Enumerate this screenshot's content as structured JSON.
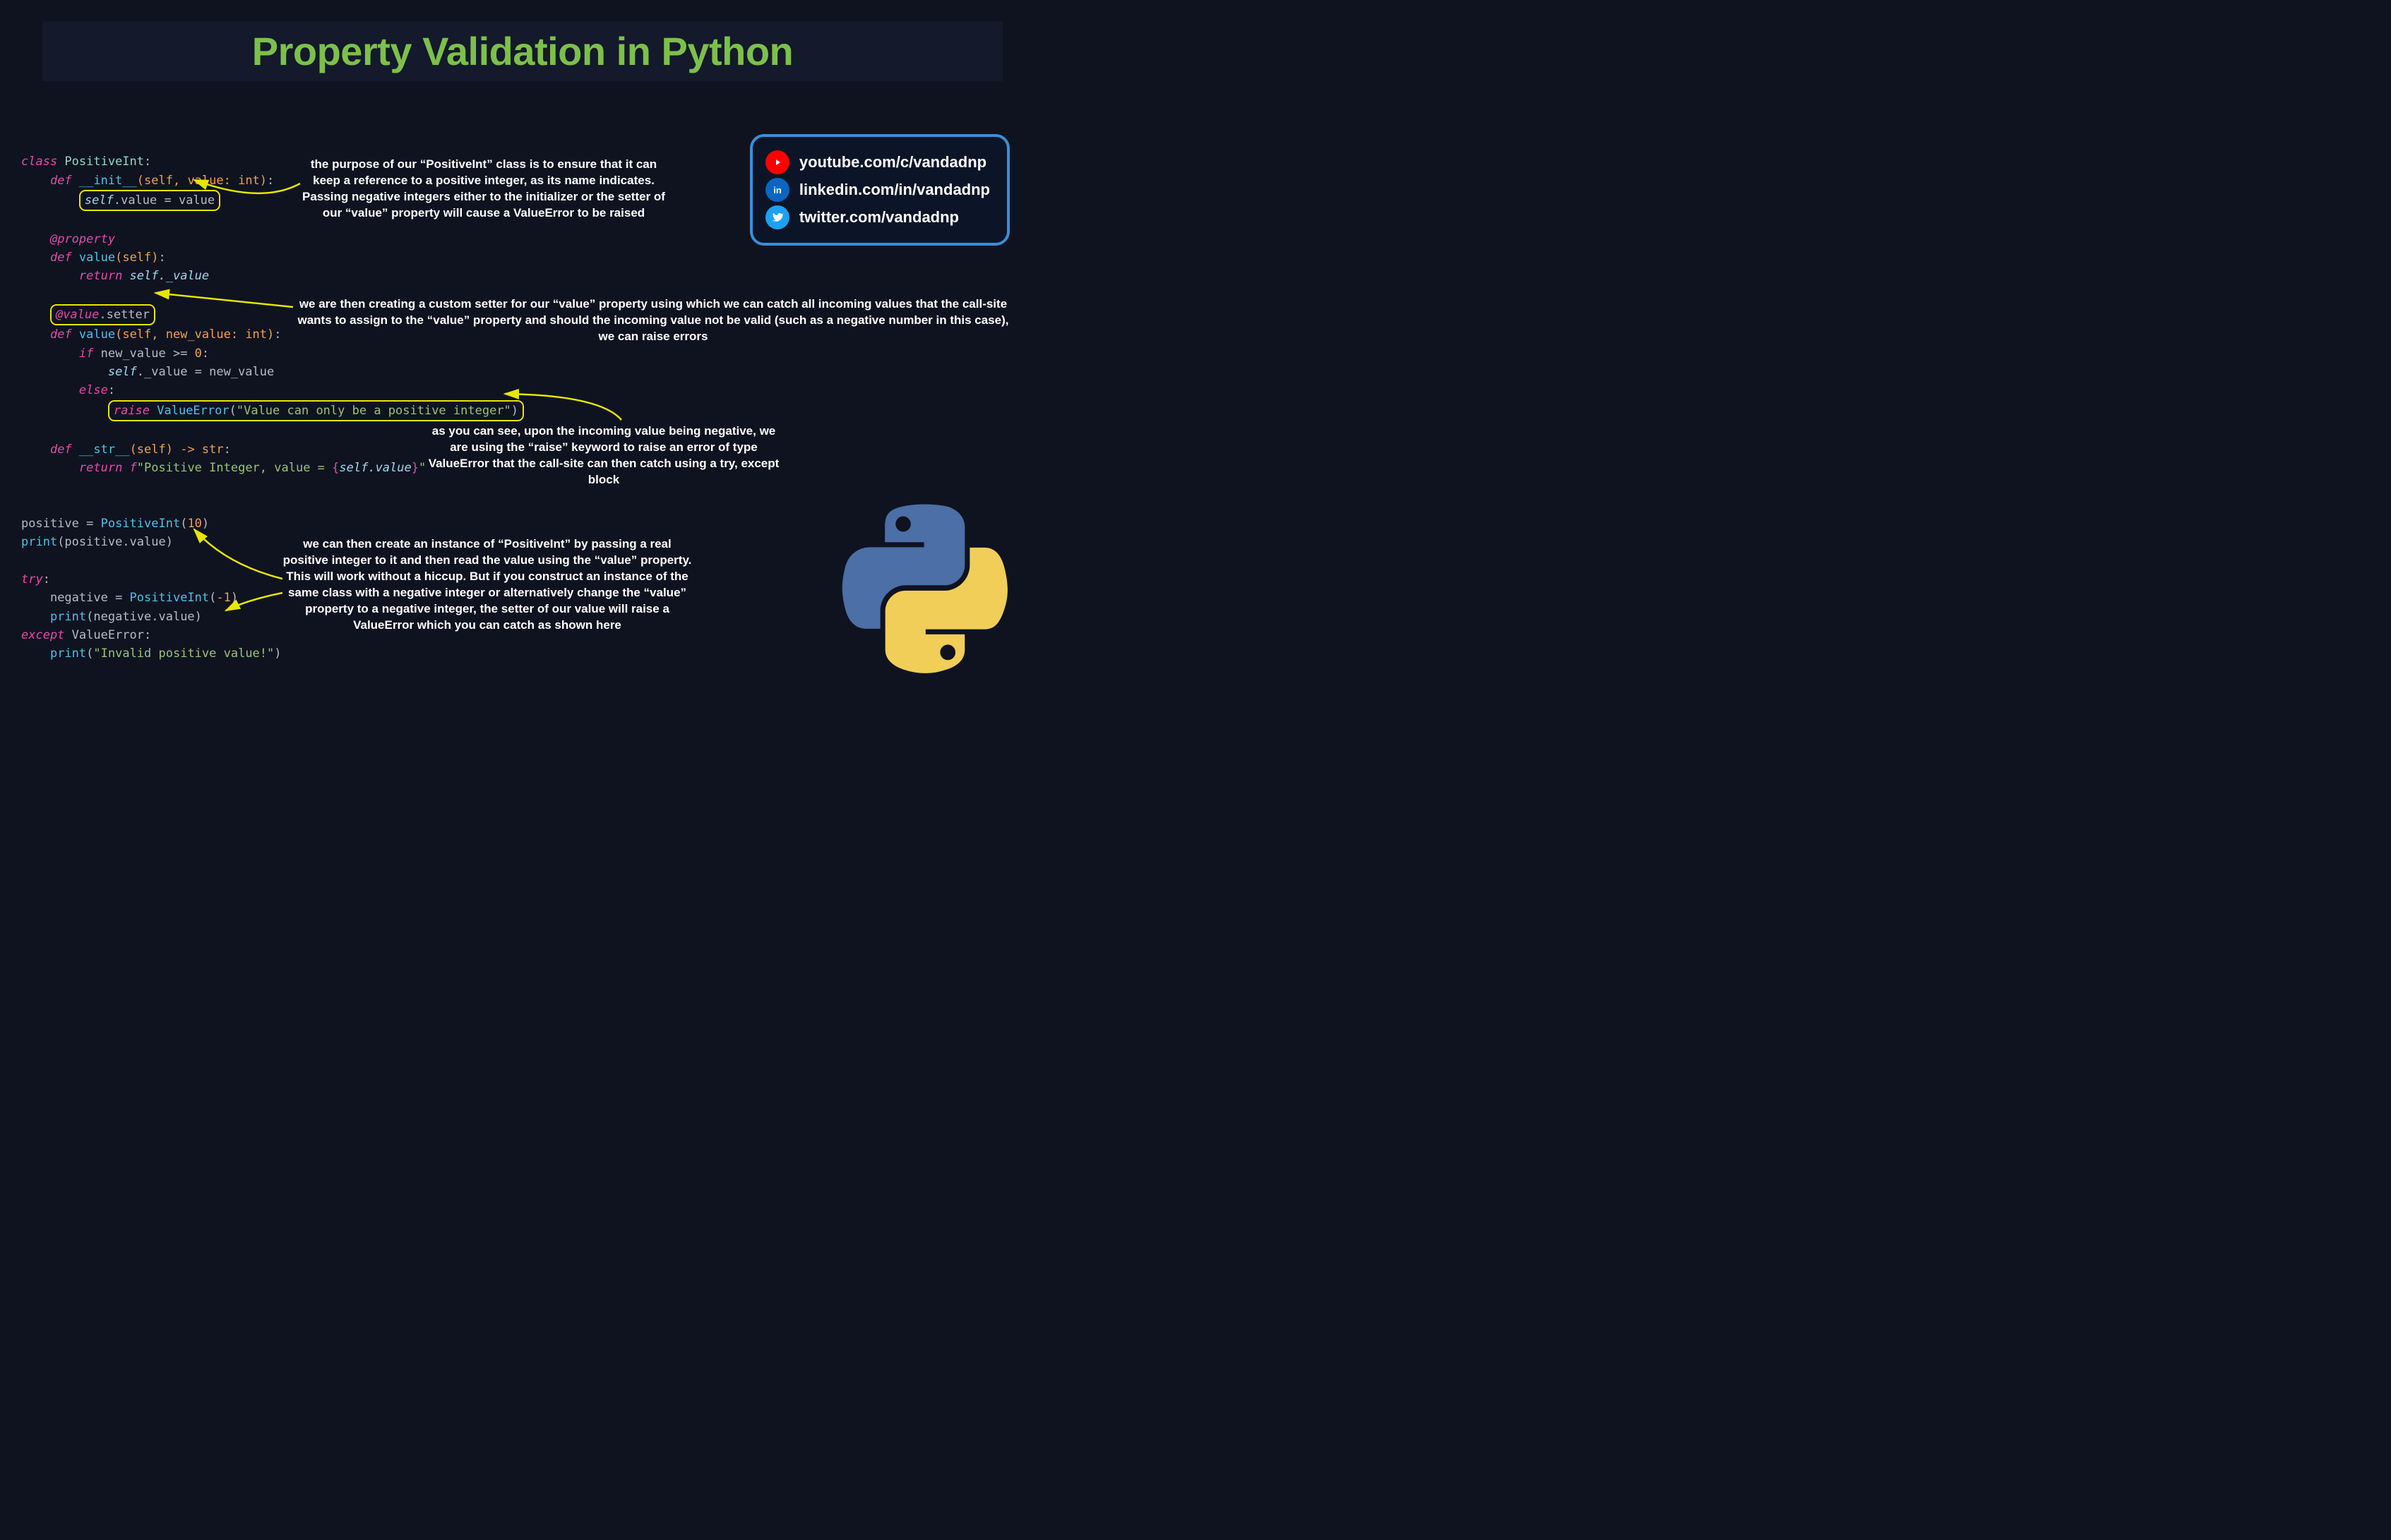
{
  "title": "Property Validation in Python",
  "social": {
    "youtube": "youtube.com/c/vandadnp",
    "linkedin": "linkedin.com/in/vandadnp",
    "twitter": "twitter.com/vandadnp"
  },
  "code": {
    "l1_class": "class",
    "l1_name": " PositiveInt",
    "l1_colon": ":",
    "l2_def": "def",
    "l2_fn": " __init__",
    "l2_params": "(self, value: int)",
    "l2_colon": ":",
    "l3_self": "self",
    "l3_dot_value_eq": ".value = value",
    "l5_deco": "@property",
    "l6_def": "def",
    "l6_fn": " value",
    "l6_params": "(self)",
    "l6_colon": ":",
    "l7_return": "return",
    "l7_selfval": " self._value",
    "l9_deco1": "@value",
    "l9_deco2": ".setter",
    "l10_def": "def",
    "l10_fn": " value",
    "l10_params": "(self, new_value: int)",
    "l10_colon": ":",
    "l11_if": "if",
    "l11_cond": " new_value >= ",
    "l11_zero": "0",
    "l11_colon": ":",
    "l12_self": "self",
    "l12_assign": "._value = new_value",
    "l13_else": "else",
    "l13_colon": ":",
    "l14_raise": "raise",
    "l14_err": " ValueError",
    "l14_paren_open": "(",
    "l14_str": "\"Value can only be a positive integer\"",
    "l14_paren_close": ")",
    "l16_def": "def",
    "l16_fn": " __str__",
    "l16_params": "(self) -> str",
    "l16_colon": ":",
    "l17_return": "return",
    "l17_fpre": " f",
    "l17_str1": "\"Positive Integer, value = ",
    "l17_brace_open": "{",
    "l17_selfv": "self.value",
    "l17_brace_close": "}",
    "l17_str2": "\"",
    "l20a": "positive = ",
    "l20b": "PositiveInt",
    "l20c": "(",
    "l20d": "10",
    "l20e": ")",
    "l21a": "print",
    "l21b": "(positive.value)",
    "l23_try": "try",
    "l23_colon": ":",
    "l24a": "negative = ",
    "l24b": "PositiveInt",
    "l24c": "(",
    "l24d": "-1",
    "l24e": ")",
    "l25a": "print",
    "l25b": "(negative.value)",
    "l26a": "except",
    "l26b": " ValueError",
    "l26c": ":",
    "l27a": "print",
    "l27b": "(",
    "l27c": "\"Invalid positive value!\"",
    "l27d": ")"
  },
  "annotations": {
    "a1": "the purpose of our “PositiveInt” class is to ensure that it can keep a reference to a positive integer, as its name indicates. Passing negative integers either to the initializer or the setter of our “value” property will cause a ValueError to be raised",
    "a2": "we are then creating a custom setter for our “value” property using which we can catch all incoming values that the call-site wants to assign to the “value” property and should the incoming value not be valid (such as a negative number in this case), we can raise errors",
    "a3": "as you can see, upon the incoming value being negative, we are using the “raise” keyword to raise an error of type ValueError that the call-site can then catch using a try, except block",
    "a4": "we can then create an instance of “PositiveInt” by passing a real positive integer to it and then read the value using the “value” property. This will work without a hiccup. But if you construct an instance of the same class with a negative integer or alternatively change the “value” property to a negative integer, the setter of our value will raise a ValueError which you can catch as shown here"
  }
}
